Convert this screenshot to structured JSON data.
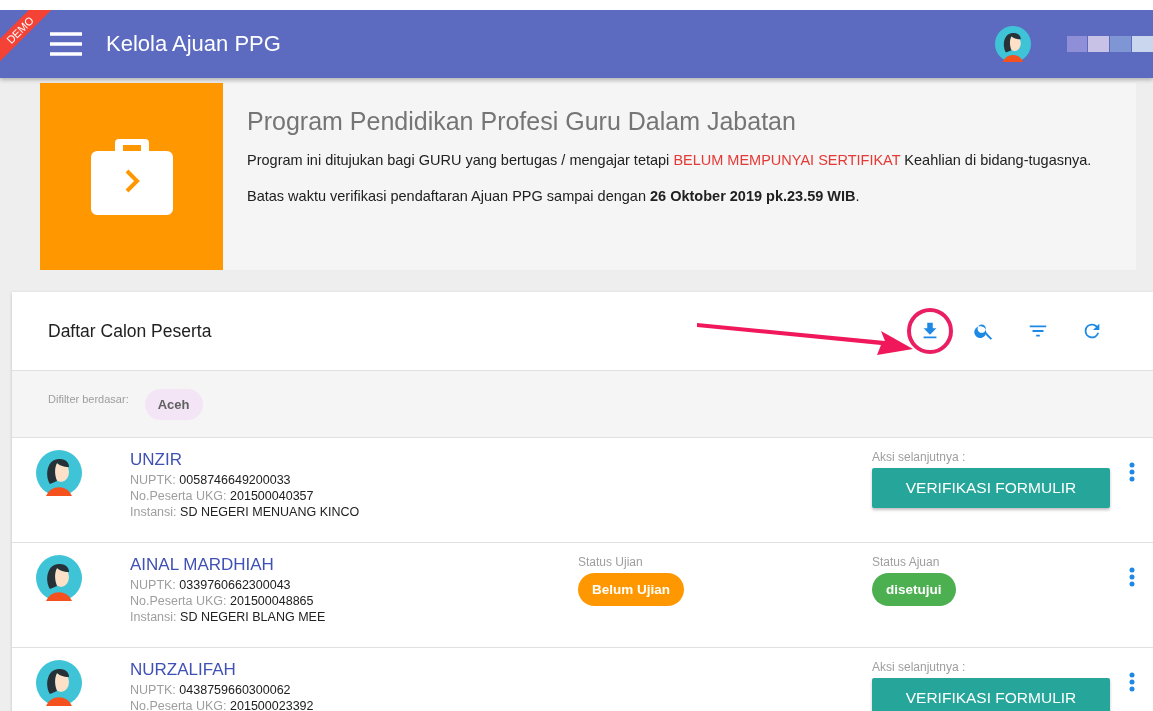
{
  "ribbon": "DEMO",
  "app_bar": {
    "title": "Kelola Ajuan PPG"
  },
  "banner": {
    "title": "Program Pendidikan Profesi Guru Dalam Jabatan",
    "intro": [
      {
        "text": "Program ini ditujukan bagi GURU yang bertugas / mengajar tetapi ",
        "emphasis": false
      },
      {
        "text": "BELUM MEMPUNYAI SERTIFIKAT",
        "emphasis": true
      },
      {
        "text": " Keahlian di bidang-tugasnya.",
        "emphasis": false
      }
    ],
    "deadline": "Batas waktu verifikasi pendaftaran Ajuan PPG sampai dengan **26 Oktober 2019 pk.23.59 WIB**."
  },
  "list": {
    "title": "Daftar Calon Peserta",
    "tools": [
      {
        "kind": "download",
        "highlighted": true
      },
      {
        "kind": "search",
        "highlighted": false
      },
      {
        "kind": "filter",
        "highlighted": false
      },
      {
        "kind": "refresh",
        "highlighted": false
      }
    ],
    "filter_label": "Difilter berdasar:",
    "filter_chips": [
      "Aceh"
    ],
    "rows": [
      {
        "kind": "action",
        "name": "UNZIR",
        "nuptk_label": "NUPTK:",
        "nuptk": "0058746649200033",
        "ukg_label": "No.Peserta UKG:",
        "ukg": "201500040357",
        "instansi_label": "Instansi:",
        "instansi": "SD NEGERI MENUANG KINCO",
        "action_label": "Aksi selanjutnya :",
        "action": "VERIFIKASI FORMULIR"
      },
      {
        "kind": "status",
        "name": "AINAL MARDHIAH",
        "nuptk_label": "NUPTK:",
        "nuptk": "0339760662300043",
        "ukg_label": "No.Peserta UKG:",
        "ukg": "201500048865",
        "instansi_label": "Instansi:",
        "instansi": "SD NEGERI BLANG MEE",
        "statuses": [
          {
            "kind": "warning",
            "label": "Status Ujian",
            "text": "Belum Ujian"
          },
          {
            "kind": "success",
            "label": "Status Ajuan",
            "text": "disetujui"
          }
        ]
      },
      {
        "kind": "action",
        "name": "NURZALIFAH",
        "nuptk_label": "NUPTK:",
        "nuptk": "0438759660300062",
        "ukg_label": "No.Peserta UKG:",
        "ukg": "201500023392",
        "action_label": "Aksi selanjutnya :",
        "action": "VERIFIKASI FORMULIR"
      }
    ]
  }
}
